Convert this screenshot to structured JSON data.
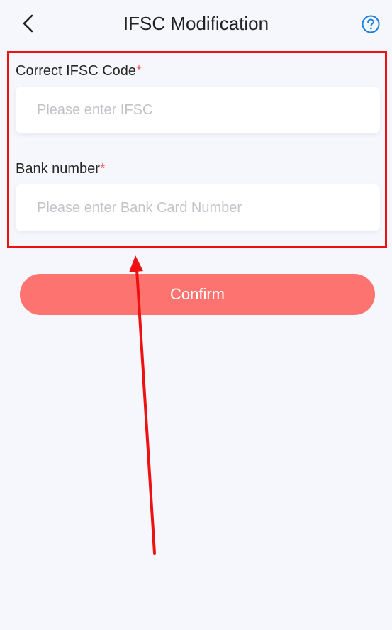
{
  "header": {
    "title": "IFSC Modification",
    "back_icon": "chevron-left-icon",
    "help_icon": "question-circle-icon",
    "accent_color": "#1a7fe0"
  },
  "form": {
    "ifsc": {
      "label": "Correct IFSC Code",
      "required_mark": "*",
      "placeholder": "Please enter IFSC",
      "value": ""
    },
    "bank_number": {
      "label": "Bank number",
      "required_mark": "*",
      "placeholder": "Please enter Bank Card Number",
      "value": ""
    }
  },
  "confirm_label": "Confirm",
  "colors": {
    "background": "#f6f7fc",
    "confirm_button": "#fd736f",
    "required_mark": "#f25c5c",
    "annotation": "#ee1111"
  }
}
